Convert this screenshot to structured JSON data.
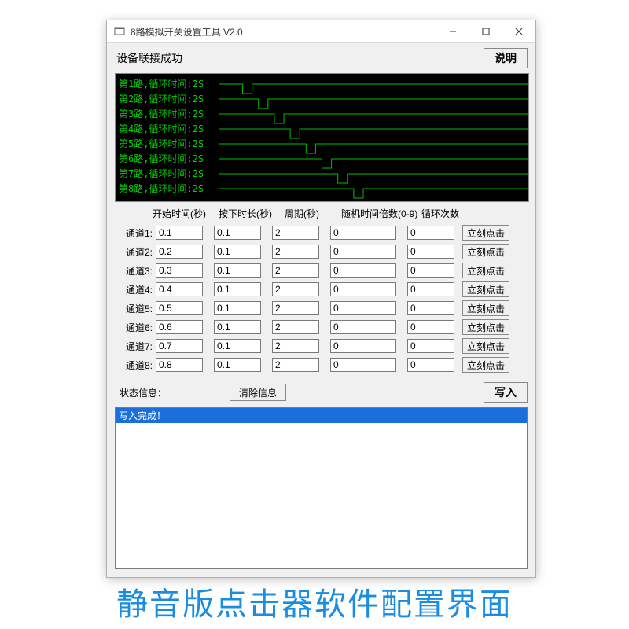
{
  "window": {
    "title": "8路模拟开关设置工具 V2.0"
  },
  "top": {
    "status_label": "设备联接成功",
    "help_button": "说明"
  },
  "waveform": {
    "lines": [
      "第1路,循环时间:2S",
      "第2路,循环时间:2S",
      "第3路,循环时间:2S",
      "第4路,循环时间:2S",
      "第5路,循环时间:2S",
      "第6路,循环时间:2S",
      "第7路,循环时间:2S",
      "第8路,循环时间:2S"
    ]
  },
  "columns": {
    "start": "开始时间(秒)",
    "press": "按下时长(秒)",
    "period": "周期(秒)",
    "rand": "随机时间倍数(0-9)",
    "loop": "循环次数"
  },
  "channels": [
    {
      "label": "通道1:",
      "start": "0.1",
      "press": "0.1",
      "period": "2",
      "rand": "0",
      "loop": "0"
    },
    {
      "label": "通道2:",
      "start": "0.2",
      "press": "0.1",
      "period": "2",
      "rand": "0",
      "loop": "0"
    },
    {
      "label": "通道3:",
      "start": "0.3",
      "press": "0.1",
      "period": "2",
      "rand": "0",
      "loop": "0"
    },
    {
      "label": "通道4:",
      "start": "0.4",
      "press": "0.1",
      "period": "2",
      "rand": "0",
      "loop": "0"
    },
    {
      "label": "通道5:",
      "start": "0.5",
      "press": "0.1",
      "period": "2",
      "rand": "0",
      "loop": "0"
    },
    {
      "label": "通道6:",
      "start": "0.6",
      "press": "0.1",
      "period": "2",
      "rand": "0",
      "loop": "0"
    },
    {
      "label": "通道7:",
      "start": "0.7",
      "press": "0.1",
      "period": "2",
      "rand": "0",
      "loop": "0"
    },
    {
      "label": "通道8:",
      "start": "0.8",
      "press": "0.1",
      "period": "2",
      "rand": "0",
      "loop": "0"
    }
  ],
  "buttons": {
    "click_now": "立刻点击",
    "clear": "清除信息",
    "write": "写入"
  },
  "status_info": {
    "label": "状态信息：",
    "log_line": "写入完成！"
  },
  "caption": "静音版点击器软件配置界面"
}
